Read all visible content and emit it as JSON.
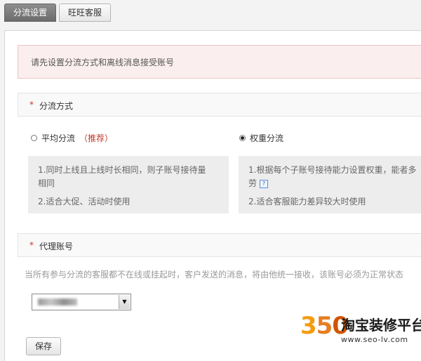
{
  "tabs": [
    {
      "label": "分流设置",
      "active": true
    },
    {
      "label": "旺旺客服",
      "active": false
    }
  ],
  "notice": "请先设置分流方式和离线消息接受账号",
  "distribution": {
    "required_mark": "*",
    "title": "分流方式",
    "options": [
      {
        "label": "平均分流",
        "tag": "（推荐）",
        "checked": false,
        "lines": [
          "1.同时上线且上线时长相同，则子账号接待量",
          "相同",
          "2.适合大促、活动时使用"
        ]
      },
      {
        "label": "权重分流",
        "tag": "",
        "checked": true,
        "lines": [
          "1.根据每个子账号接待能力设置权重，能者多",
          "劳",
          "2.适合客服能力差异较大时使用"
        ]
      }
    ]
  },
  "agent_account": {
    "required_mark": "*",
    "title": "代理账号",
    "hint": "当所有参与分流的客服都不在线或挂起时，客户发送的消息，将由他统一接收，该账号必须为正常状态",
    "select_icon": "dropdown-arrow-icon"
  },
  "save_label": "保存",
  "watermark": {
    "digits": [
      "3",
      "5",
      "0"
    ],
    "title": "淘宝装修平台",
    "url": "www.seo-lv.com",
    "colors": {
      "orange": "#f39c12",
      "dark": "#1a1a1a"
    }
  },
  "colors": {
    "required": "#d23232",
    "recommend": "#c0392b",
    "notice_bg": "#fbeeee"
  }
}
